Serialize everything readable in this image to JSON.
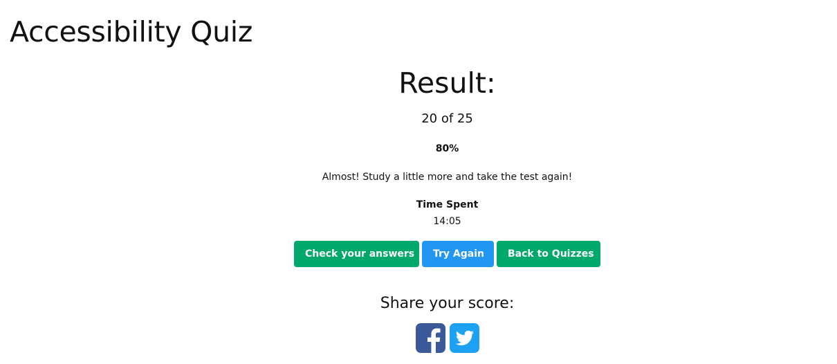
{
  "app": {
    "title": "Accessibility Quiz"
  },
  "result": {
    "heading": "Result:",
    "score": "20 of 25",
    "percent": "80%",
    "message": "Almost! Study a little more and take the test again!",
    "time_label": "Time Spent",
    "time_value": "14:05"
  },
  "buttons": {
    "check": "Check your answers",
    "try_again": "Try Again",
    "back": "Back to Quizzes"
  },
  "share": {
    "heading": "Share your score:",
    "icons": [
      "facebook-icon",
      "twitter-icon"
    ]
  },
  "colors": {
    "primary_green": "#00a86b",
    "try_again_blue": "#2196f3",
    "facebook": "#3b5998",
    "twitter": "#1da1f2"
  }
}
